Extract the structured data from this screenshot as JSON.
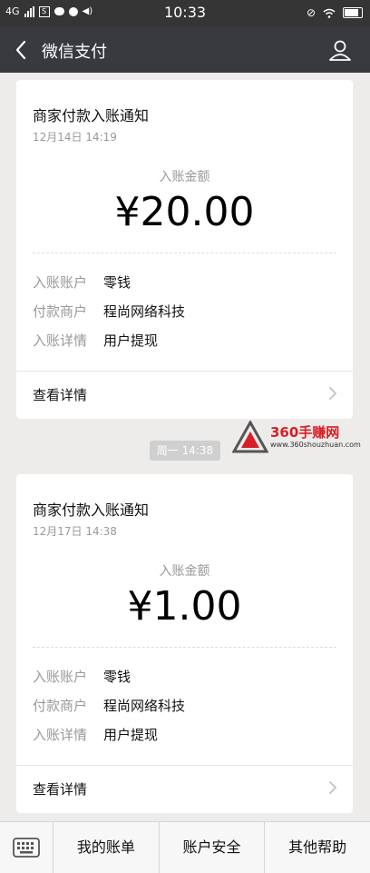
{
  "status_bar": {
    "network": "4G",
    "time": "10:33",
    "icons": [
      "signal-icon",
      "s-app-icon",
      "chat-icon",
      "clock-app-icon",
      "volume-icon",
      "alarm-off-icon",
      "wifi-icon",
      "battery-icon"
    ]
  },
  "nav": {
    "title": "微信支付",
    "back_icon": "back-arrow-icon",
    "profile_icon": "user-icon"
  },
  "messages": [
    {
      "title": "商家付款入账通知",
      "time": "12月14日  14:19",
      "amount_label": "入账金额",
      "amount": "¥20.00",
      "rows": [
        {
          "label": "入账账户",
          "value": "零钱"
        },
        {
          "label": "付款商户",
          "value": "程尚网络科技"
        },
        {
          "label": "入账详情",
          "value": "用户提现"
        }
      ],
      "detail_link": "查看详情"
    },
    {
      "title": "商家付款入账通知",
      "time": "12月17日  14:38",
      "amount_label": "入账金额",
      "amount": "¥1.00",
      "rows": [
        {
          "label": "入账账户",
          "value": "零钱"
        },
        {
          "label": "付款商户",
          "value": "程尚网络科技"
        },
        {
          "label": "入账详情",
          "value": "用户提现"
        }
      ],
      "detail_link": "查看详情"
    }
  ],
  "timestamp_divider": "周一 14:38",
  "watermark": {
    "brand": "360手赚网",
    "url": "www.360shouzhuan.com"
  },
  "bottom_menu": {
    "keyboard_icon": "keyboard-icon",
    "items": [
      "我的账单",
      "账户安全",
      "其他帮助"
    ]
  },
  "colors": {
    "nav_bg": "#393a3f",
    "status_bg": "#353535",
    "page_bg": "#eeebeb",
    "watermark_red": "#d61f26"
  }
}
